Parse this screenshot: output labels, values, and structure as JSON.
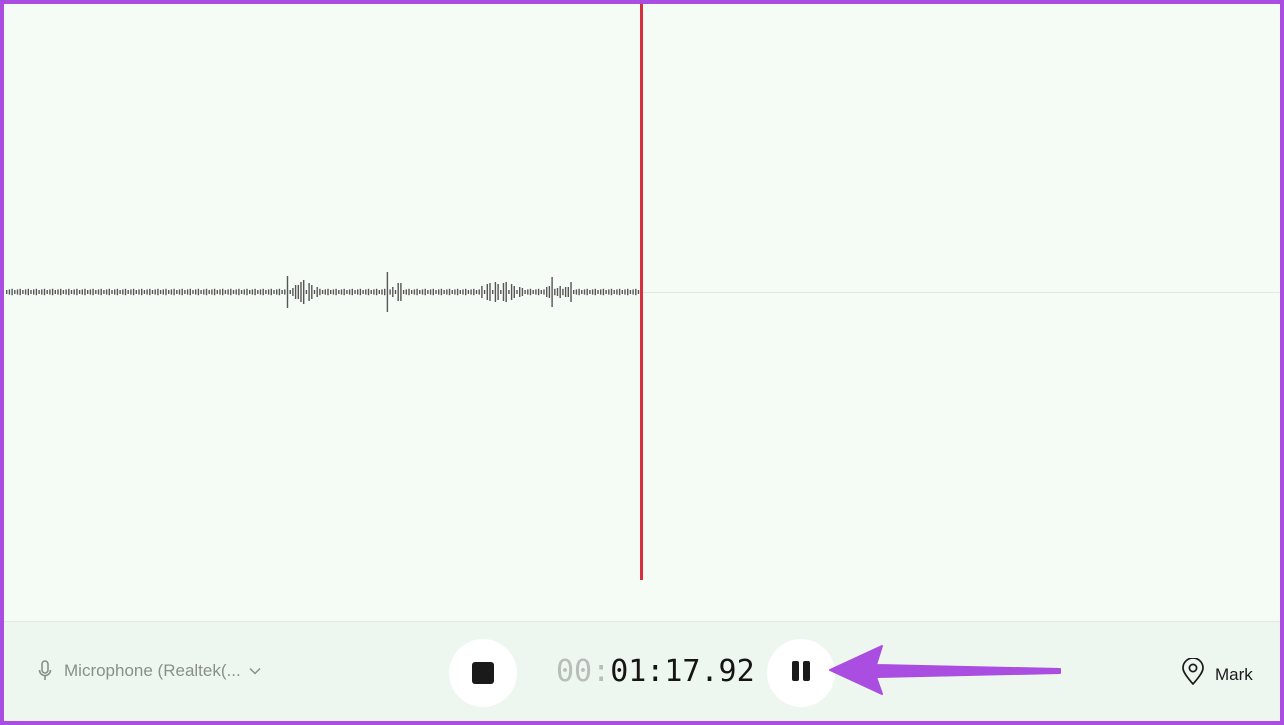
{
  "recorder": {
    "timer_dim": "00:",
    "timer_main": "01:17.92",
    "microphone_label": "Microphone (Realtek(...",
    "mark_label": "Mark"
  },
  "colors": {
    "accent_annotation": "#a94ee0",
    "playhead": "#d62f3d",
    "waveform": "#555555",
    "background": "#f5fcf6"
  },
  "icons": {
    "microphone": "microphone-icon",
    "chevron": "chevron-down-icon",
    "stop": "stop-icon",
    "pause": "pause-icon",
    "mark": "location-pin-icon",
    "annotation": "arrow-icon"
  }
}
